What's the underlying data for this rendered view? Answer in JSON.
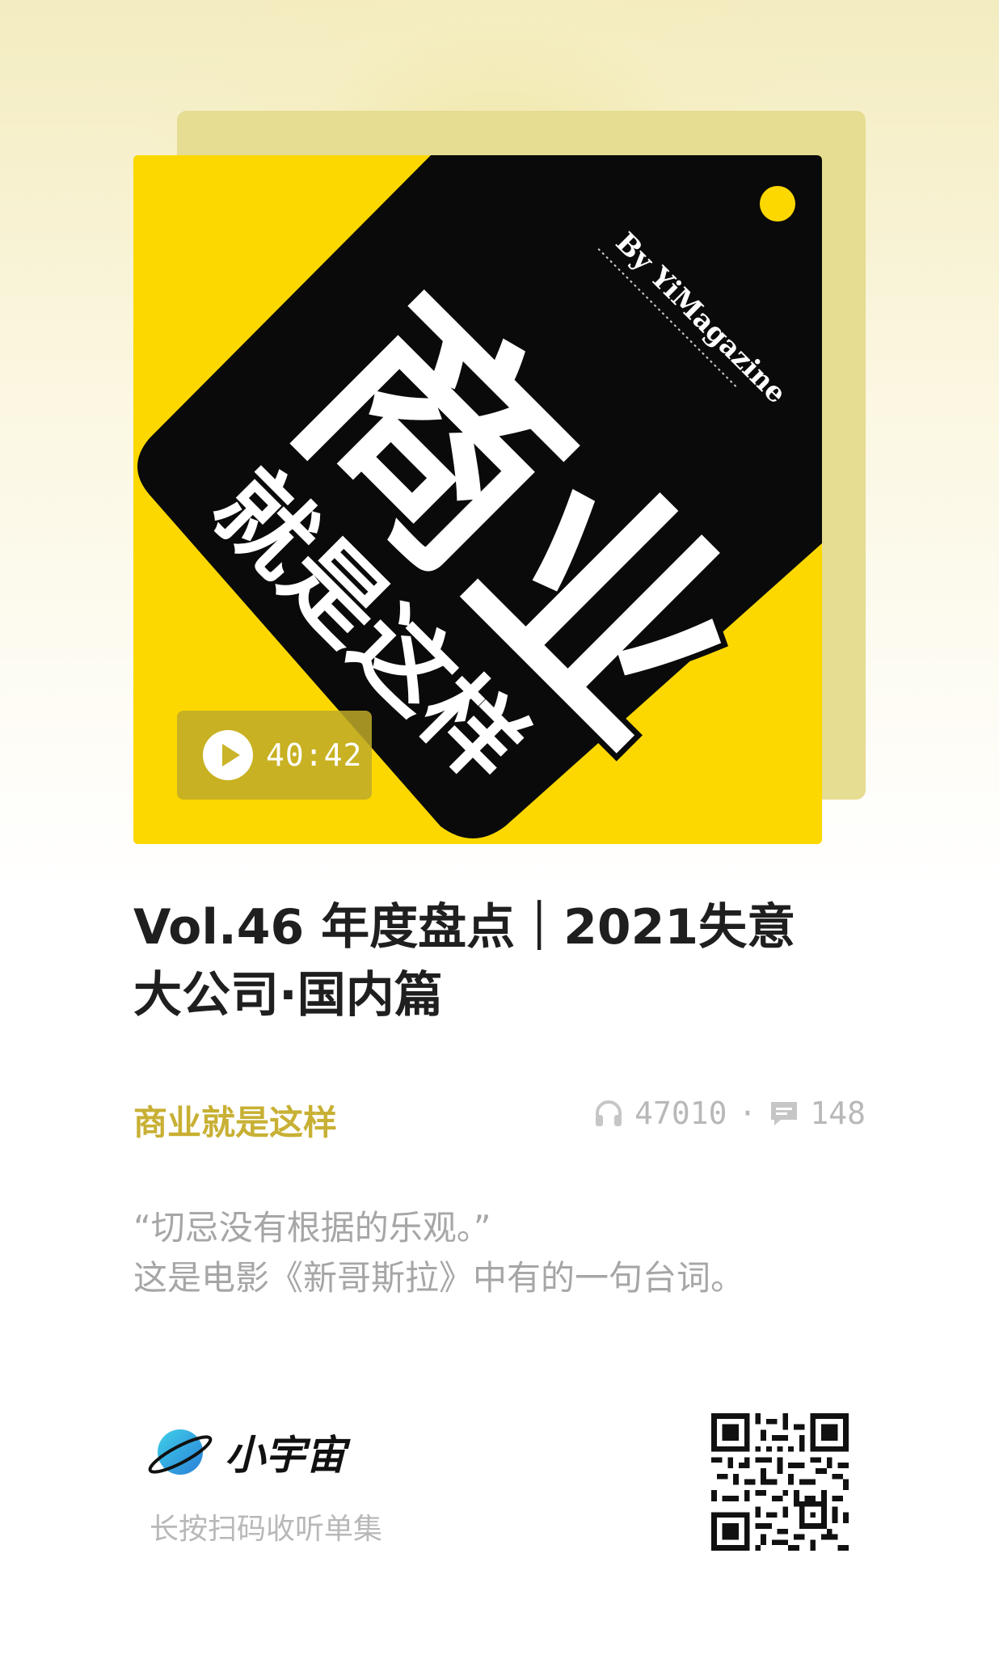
{
  "cover": {
    "headline_big": "商业",
    "headline_sub": "就是这样",
    "by_line": "By YiMagazine",
    "duration": "40:42",
    "colors": {
      "yellow": "#fcd800",
      "black": "#0a0a0a",
      "accent": "#c8b034"
    }
  },
  "episode": {
    "title_line1": "Vol.46 年度盘点｜2021失意",
    "title_line2": "大公司·国内篇",
    "podcast_name": "商业就是这样",
    "plays": "47010",
    "separator": "·",
    "comments": "148",
    "description_line1": "“切忌没有根据的乐观。”",
    "description_line2": "这是电影《新哥斯拉》中有的一句台词。"
  },
  "footer": {
    "brand_name": "小宇宙",
    "scan_hint": "长按扫码收听单集"
  },
  "icons": {
    "play": "play-icon",
    "headphones": "headphones-icon",
    "comment": "comment-icon",
    "planet": "planet-logo-icon",
    "qr": "qr-code"
  }
}
